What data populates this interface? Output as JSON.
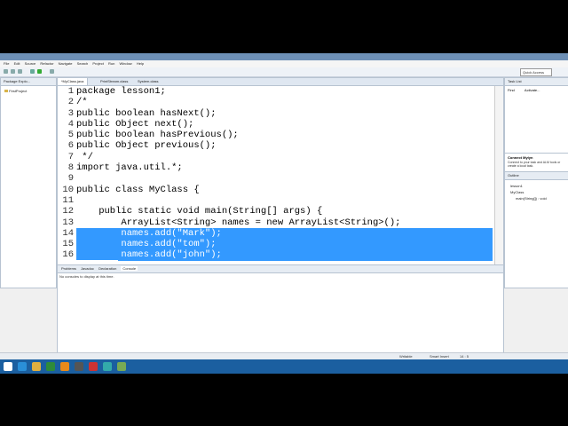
{
  "window": {
    "menu": [
      "File",
      "Edit",
      "Source",
      "Refactor",
      "Navigate",
      "Search",
      "Project",
      "Run",
      "Window",
      "Help"
    ],
    "quick_access": "Quick Access"
  },
  "left_panel": {
    "tab": "Package Explo...",
    "item": "FirstProject"
  },
  "editor": {
    "tabs": [
      "*MyClass.java",
      "PrintStream.class",
      "System.class"
    ],
    "lines": [
      {
        "n": "1",
        "t": "package lesson1;",
        "sel": false
      },
      {
        "n": "2",
        "t": "/*",
        "sel": false
      },
      {
        "n": "3",
        "t": "public boolean hasNext();",
        "sel": false
      },
      {
        "n": "4",
        "t": "public Object next();",
        "sel": false
      },
      {
        "n": "5",
        "t": "public boolean hasPrevious();",
        "sel": false
      },
      {
        "n": "6",
        "t": "public Object previous();",
        "sel": false
      },
      {
        "n": "7",
        "t": " */",
        "sel": false
      },
      {
        "n": "8",
        "t": "import java.util.*;",
        "sel": false
      },
      {
        "n": "9",
        "t": "",
        "sel": false
      },
      {
        "n": "10",
        "t": "public class MyClass {",
        "sel": false
      },
      {
        "n": "11",
        "t": "",
        "sel": false
      },
      {
        "n": "12",
        "t": "    public static void main(String[] args) {",
        "sel": false
      },
      {
        "n": "13",
        "t": "        ArrayList<String> names = new ArrayList<String>();",
        "sel": false
      },
      {
        "n": "14",
        "t": "        names.add(\"Mark\");",
        "sel": true
      },
      {
        "n": "15",
        "t": "        names.add(\"tom\");",
        "sel": true
      },
      {
        "n": "16",
        "t": "        names.add(\"john\");",
        "sel": true
      }
    ]
  },
  "right_top": {
    "tab": "Task List",
    "find_label": "Find",
    "activate": "Activate..."
  },
  "connect_mylyn": {
    "title": "Connect Mylyn",
    "text": "Connect to your task and ALM tools or create a local task."
  },
  "outline": {
    "tab": "Outline",
    "items": [
      "lesson1",
      "MyClass",
      "main(String[]) : void"
    ]
  },
  "bottom_panel": {
    "tabs": [
      "Problems",
      "Javadoc",
      "Declaration",
      "Console"
    ],
    "message": "No consoles to display at this time."
  },
  "status": {
    "writable": "Writable",
    "insert": "Smart Insert",
    "position": "14 : 5"
  }
}
